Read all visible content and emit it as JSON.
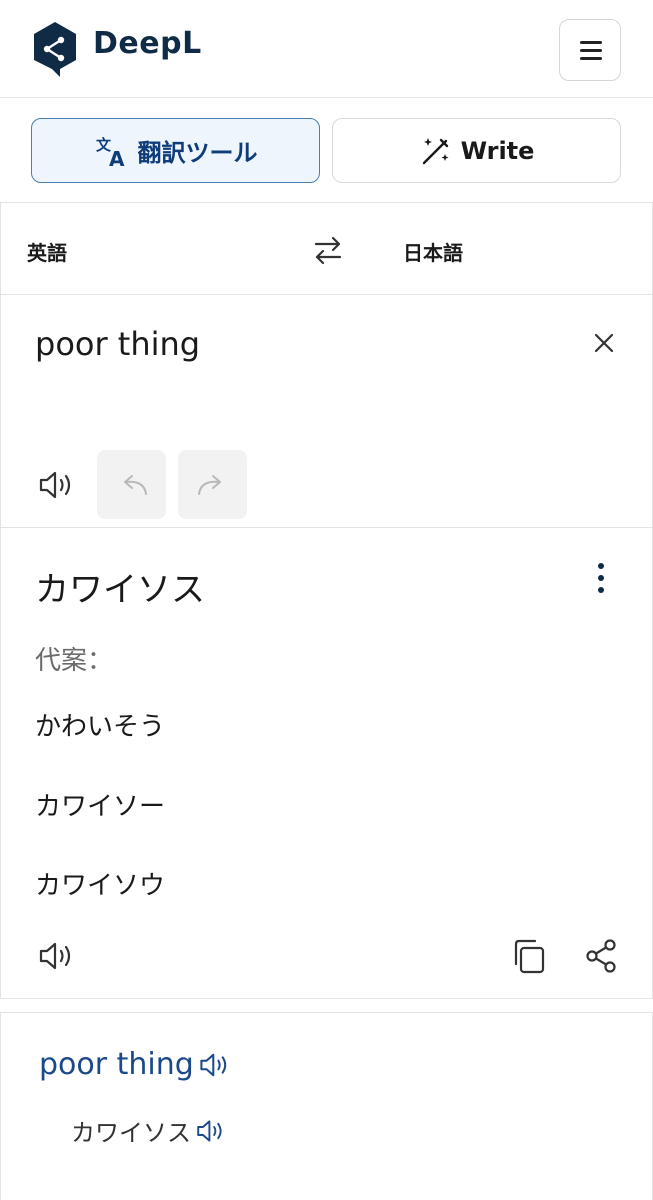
{
  "header": {
    "brand": "DeepL",
    "logo_icon": "deepl-logo-icon",
    "menu_icon": "hamburger-menu-icon",
    "brand_color": "#0f2b46"
  },
  "tabs": [
    {
      "label": "翻訳ツール",
      "icon": "translate-icon",
      "active": true
    },
    {
      "label": "Write",
      "icon": "magic-wand-icon",
      "active": false
    }
  ],
  "languages": {
    "source": "英語",
    "target": "日本語",
    "swap_icon": "swap-arrows-icon"
  },
  "source": {
    "text": "poor thing",
    "clear_icon": "close-icon",
    "speaker_icon": "speaker-icon",
    "undo_icon": "undo-icon",
    "redo_icon": "redo-icon"
  },
  "target": {
    "text": "カワイソス",
    "more_icon": "more-vertical-icon",
    "alternatives_label": "代案：",
    "alternatives": [
      "かわいそう",
      "カワイソー",
      "カワイソウ"
    ],
    "speaker_icon": "speaker-icon",
    "copy_icon": "copy-icon",
    "share_icon": "share-icon"
  },
  "dictionary": {
    "headword": "poor thing",
    "entry": "カワイソス",
    "link_color": "#1b4a8a"
  }
}
